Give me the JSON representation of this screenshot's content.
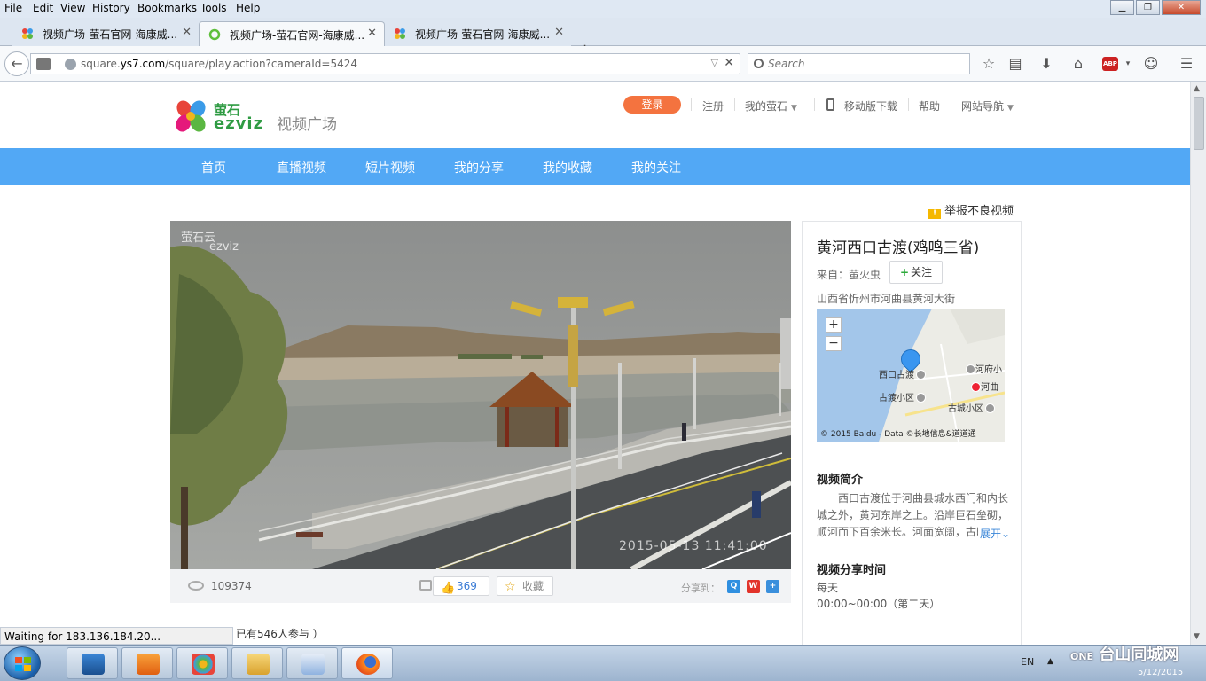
{
  "menubar": {
    "items": [
      "File",
      "Edit",
      "View",
      "History",
      "Bookmarks",
      "Tools",
      "Help"
    ]
  },
  "tabs": [
    {
      "title": "视频广场-萤石官网-海康威...",
      "active": false
    },
    {
      "title": "视频广场-萤石官网-海康威...",
      "active": true
    },
    {
      "title": "视频广场-萤石官网-海康威...",
      "active": false
    }
  ],
  "nav": {
    "url_prefix": "square.",
    "url_domain": "ys7.com",
    "url_path": "/square/play.action?cameraId=5424",
    "search_placeholder": "Search"
  },
  "header": {
    "logo_cn": "萤石",
    "logo_en": "ezviz",
    "logo_sub": "视频广场",
    "login": "登录",
    "register": "注册",
    "my_ezviz": "我的萤石",
    "mobile": "移动版下载",
    "help": "帮助",
    "site_nav": "网站导航"
  },
  "mainnav": {
    "items": [
      "首页",
      "直播视频",
      "短片视频",
      "我的分享",
      "我的收藏",
      "我的关注"
    ]
  },
  "report": "举报不良视频",
  "video": {
    "osd_logo_cn": "萤石云",
    "osd_logo_en": "ezviz",
    "timestamp": "2015-05-13 11:41:00"
  },
  "video_bar": {
    "views": "109374",
    "comments": "546",
    "likes": "369",
    "favorite": "收藏",
    "share_label": "分享到："
  },
  "participants": "已有546人参与 ）",
  "panel": {
    "title": "黄河西口古渡(鸡鸣三省)",
    "source": "来自：萤火虫",
    "follow": "关注",
    "address": "山西省忻州市河曲县黄河大街",
    "map": {
      "labels": [
        "西口古渡",
        "古渡小区",
        "河府小",
        "河曲",
        "古城小区"
      ],
      "copyright": "© 2015 Baidu - Data ©",
      "copyright_tail": "长地信息&道道通"
    },
    "intro_heading": "视频简介",
    "intro_text": "西口古渡位于河曲县城水西门和内长城之外，黄河东岸之上。沿岸巨石垒砌，顺河而下百余米长。河面宽阔，古时渡口繁忙",
    "expand": "展开",
    "share_time_heading": "视频分享时间",
    "share_time_freq": "每天",
    "share_time_range": "00:00~00:00（第二天）"
  },
  "status": "Waiting for 183.136.184.20...",
  "tray": {
    "lang": "EN",
    "date": "5/12/2015"
  },
  "watermark": {
    "brand": "台山同城网",
    "sub": "ONE"
  }
}
